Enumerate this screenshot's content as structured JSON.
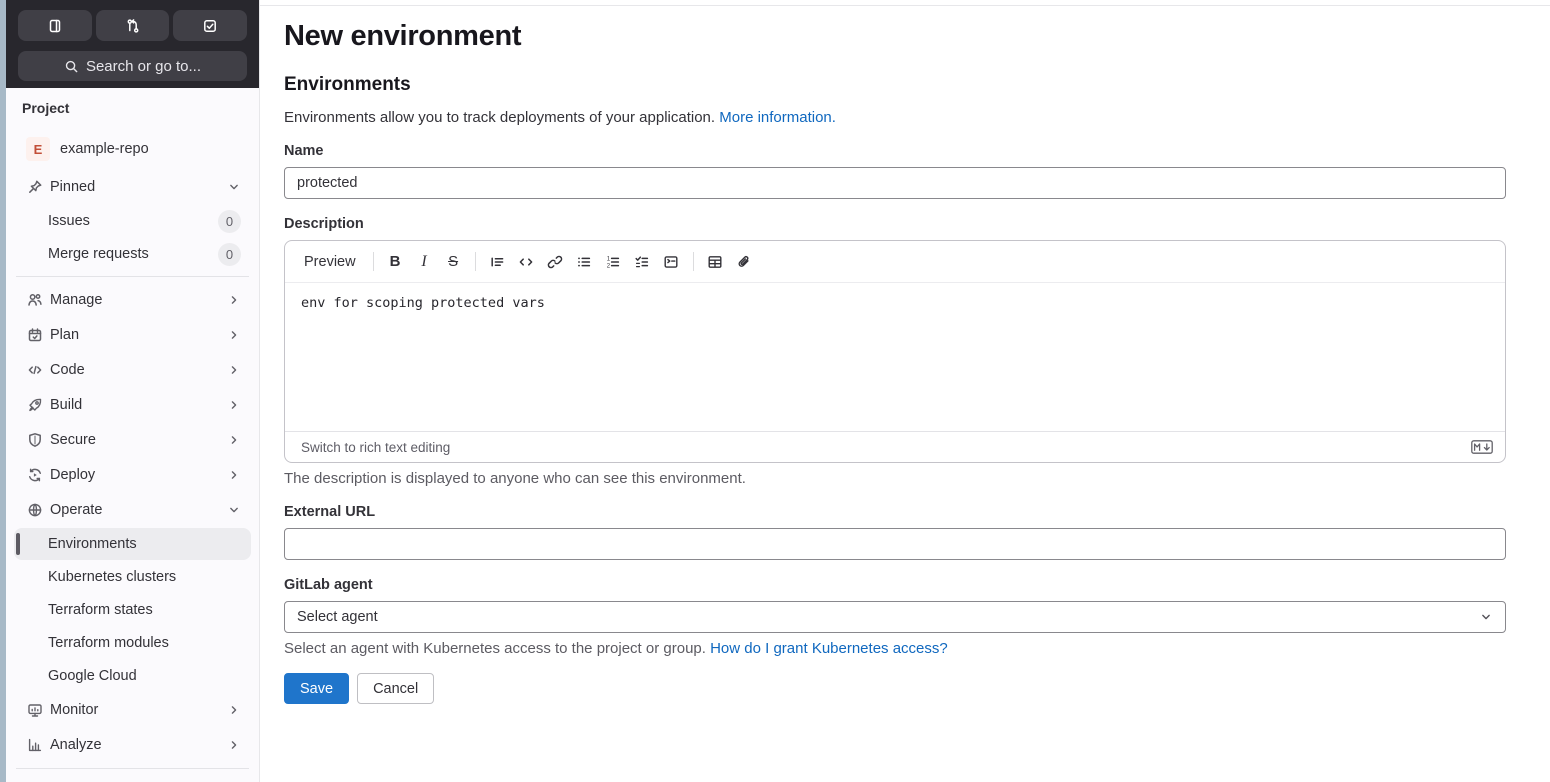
{
  "colors": {
    "accent_blue": "#1f75cb",
    "link_blue": "#1068bf",
    "sidebar_header_bg": "#28272d",
    "sidebar_bg": "#fbfafd",
    "active_item_bg": "#ececef",
    "avatar_bg": "#fdf1ee",
    "avatar_text": "#c24f38"
  },
  "sidebar": {
    "shortcuts": [
      {
        "icon": "document-icon"
      },
      {
        "icon": "merge-request-icon"
      },
      {
        "icon": "todo-checkbox-icon"
      }
    ],
    "search": {
      "icon": "search-icon",
      "placeholder": "Search or go to..."
    },
    "section_label": "Project",
    "project": {
      "avatar_letter": "E",
      "name": "example-repo"
    },
    "pinned": {
      "label": "Pinned",
      "icon": "pin-icon",
      "items": [
        {
          "label": "Issues",
          "count": "0"
        },
        {
          "label": "Merge requests",
          "count": "0"
        }
      ]
    },
    "nav": [
      {
        "label": "Manage",
        "icon": "users-icon"
      },
      {
        "label": "Plan",
        "icon": "calendar-icon"
      },
      {
        "label": "Code",
        "icon": "code-icon"
      },
      {
        "label": "Build",
        "icon": "rocket-icon"
      },
      {
        "label": "Secure",
        "icon": "shield-icon"
      },
      {
        "label": "Deploy",
        "icon": "deploy-icon"
      },
      {
        "label": "Operate",
        "icon": "globe-icon",
        "expanded": true
      }
    ],
    "operate_children": [
      {
        "label": "Environments",
        "active": true
      },
      {
        "label": "Kubernetes clusters"
      },
      {
        "label": "Terraform states"
      },
      {
        "label": "Terraform modules"
      },
      {
        "label": "Google Cloud"
      }
    ],
    "nav_bottom": [
      {
        "label": "Monitor",
        "icon": "monitor-icon"
      },
      {
        "label": "Analyze",
        "icon": "chart-icon"
      }
    ]
  },
  "main": {
    "page_title": "New environment",
    "section_heading": "Environments",
    "intro": {
      "text": "Environments allow you to track deployments of your application.",
      "link": "More information."
    },
    "name_field": {
      "label": "Name",
      "value": "protected"
    },
    "description": {
      "label": "Description",
      "toolbar": {
        "preview": "Preview",
        "glyphs": {
          "bold": "B",
          "italic": "I",
          "strikethrough": "S"
        },
        "icons": [
          "bold-icon",
          "italic-icon",
          "strikethrough-icon",
          "quote-icon",
          "code-icon",
          "link-icon",
          "bullet-list-icon",
          "numbered-list-icon",
          "task-list-icon",
          "collapsible-section-icon",
          "table-icon",
          "attach-file-icon"
        ]
      },
      "value": "env for scoping protected vars",
      "switch_label": "Switch to rich text editing",
      "markdown_icon": "markdown-icon",
      "helper": "The description is displayed to anyone who can see this environment."
    },
    "external_url": {
      "label": "External URL",
      "value": ""
    },
    "gitlab_agent": {
      "label": "GitLab agent",
      "selected": "Select agent",
      "helper": "Select an agent with Kubernetes access to the project or group.",
      "helper_link": "How do I grant Kubernetes access?"
    },
    "actions": {
      "save": "Save",
      "cancel": "Cancel"
    }
  }
}
